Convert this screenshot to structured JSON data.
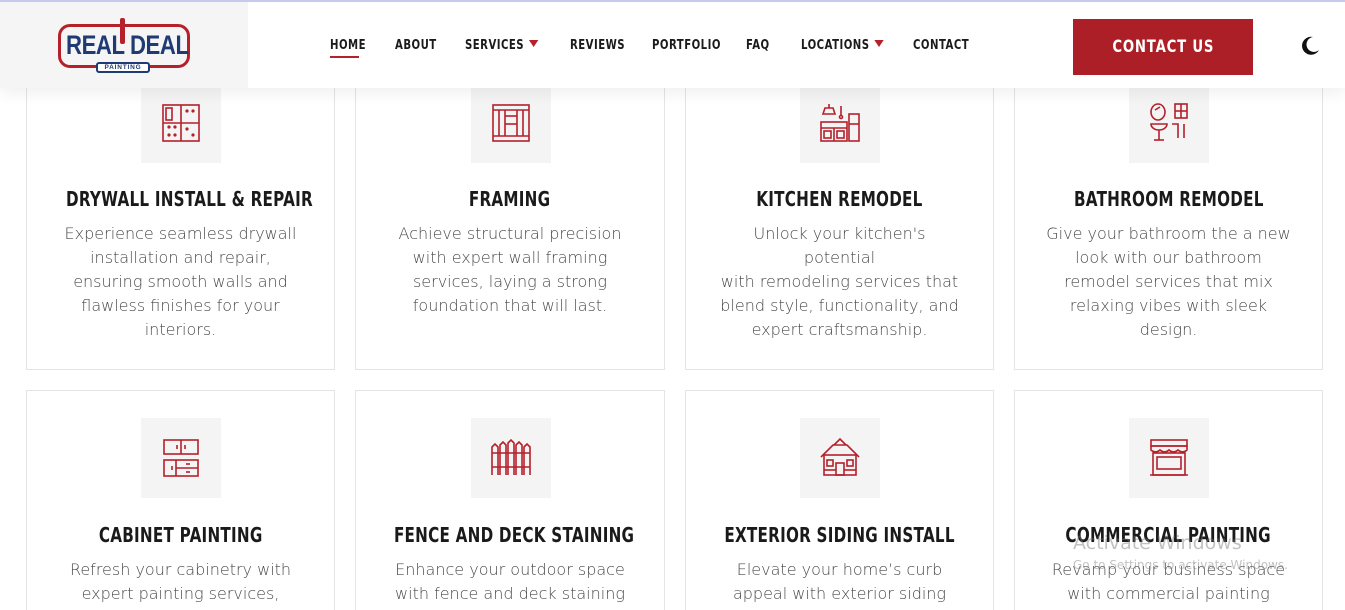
{
  "header": {
    "logo": {
      "main": "REAL DEAL",
      "sub": "PAINTING"
    },
    "nav": [
      {
        "label": "HOME",
        "active": true,
        "dropdown": false
      },
      {
        "label": "ABOUT",
        "active": false,
        "dropdown": false
      },
      {
        "label": "SERVICES",
        "active": false,
        "dropdown": true
      },
      {
        "label": "REVIEWS",
        "active": false,
        "dropdown": false
      },
      {
        "label": "PORTFOLIO",
        "active": false,
        "dropdown": false
      },
      {
        "label": "FAQ",
        "active": false,
        "dropdown": false
      },
      {
        "label": "LOCATIONS",
        "active": false,
        "dropdown": true
      },
      {
        "label": "CONTACT",
        "active": false,
        "dropdown": false
      }
    ],
    "cta_label": "CONTACT US",
    "theme_toggle_icon": "moon-icon"
  },
  "colors": {
    "accent": "#ac1f27",
    "navy": "#1f3b73",
    "icon_bg": "#f4f4f4"
  },
  "services": [
    {
      "title": "DRYWALL INSTALL & REPAIR",
      "icon": "drywall-icon",
      "desc": [
        "Experience seamless drywall",
        "installation and repair,",
        "ensuring smooth walls and",
        "flawless finishes for your",
        "interiors."
      ]
    },
    {
      "title": "FRAMING",
      "icon": "framing-icon",
      "desc": [
        "Achieve structural precision",
        "with expert wall framing",
        "services, laying a strong",
        "foundation that will last."
      ]
    },
    {
      "title": "KITCHEN REMODEL",
      "icon": "kitchen-icon",
      "desc": [
        "Unlock your kitchen's potential",
        "with remodeling services that",
        "blend style, functionality, and",
        "expert craftsmanship."
      ]
    },
    {
      "title": "BATHROOM REMODEL",
      "icon": "bathroom-icon",
      "desc": [
        "Give your bathroom the a new",
        "look with our bathroom",
        "remodel services that mix",
        "relaxing vibes with sleek",
        "design."
      ]
    },
    {
      "title": "CABINET PAINTING",
      "icon": "cabinet-icon",
      "desc": [
        "Refresh your cabinetry with",
        "expert painting services,"
      ]
    },
    {
      "title": "FENCE AND DECK STAINING",
      "icon": "fence-icon",
      "desc": [
        "Enhance your outdoor space",
        "with fence and deck staining"
      ]
    },
    {
      "title": "EXTERIOR SIDING INSTALL",
      "icon": "house-icon",
      "desc": [
        "Elevate your home’s curb",
        "appeal with exterior siding"
      ]
    },
    {
      "title": "COMMERCIAL PAINTING",
      "icon": "storefront-icon",
      "desc": [
        "Revamp your business space",
        "with commercial painting"
      ]
    }
  ],
  "watermark": {
    "title": "Activate Windows",
    "sub": "Go to Settings to activate Windows."
  }
}
